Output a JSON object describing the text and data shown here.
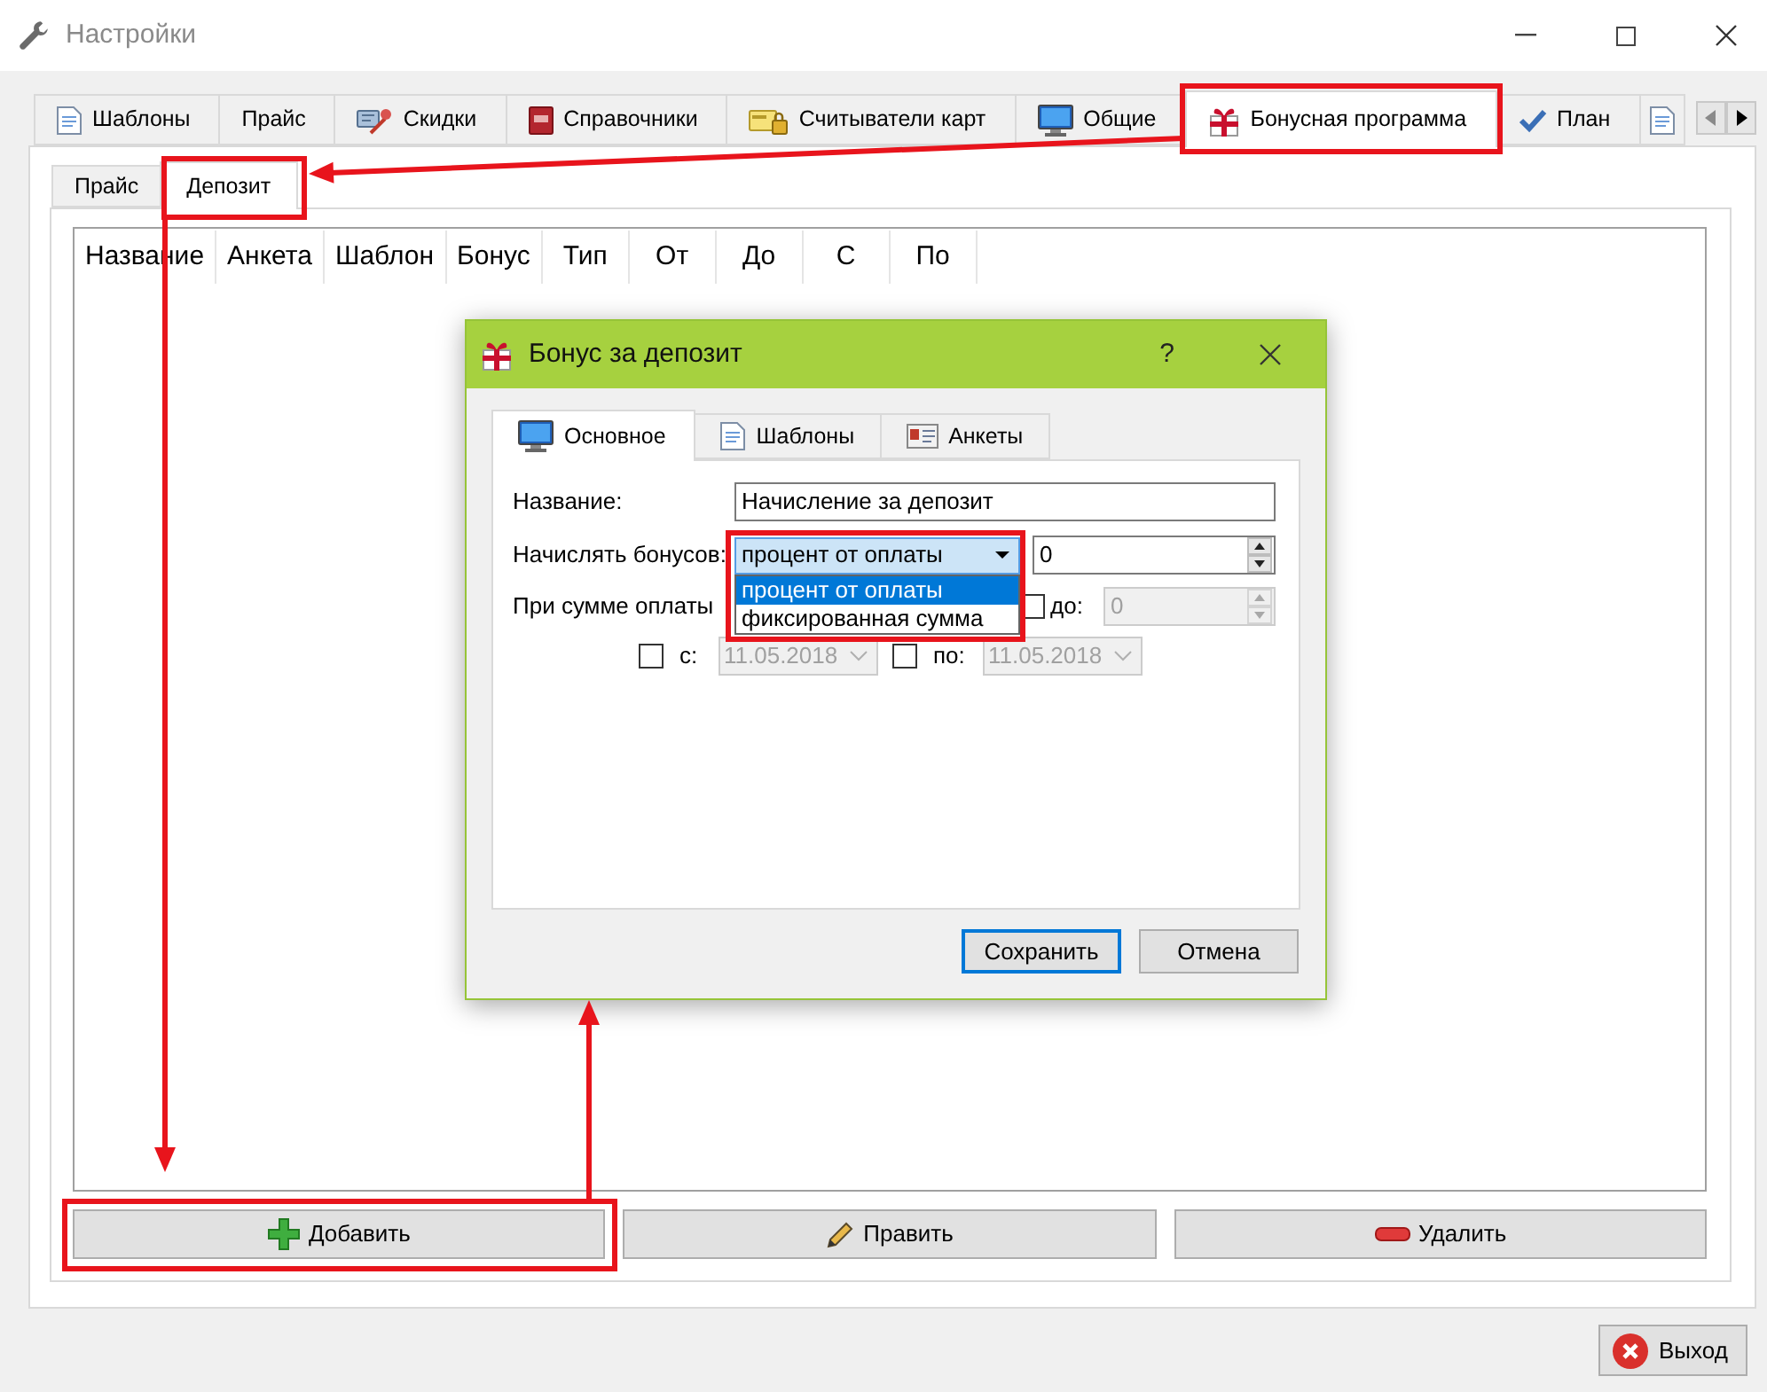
{
  "window": {
    "title": "Настройки"
  },
  "tabs": [
    {
      "label": "Шаблоны",
      "selected": false,
      "highlighted": false
    },
    {
      "label": "Прайс",
      "selected": false,
      "highlighted": false
    },
    {
      "label": "Скидки",
      "selected": false,
      "highlighted": false
    },
    {
      "label": "Справочники",
      "selected": false,
      "highlighted": false
    },
    {
      "label": "Считыватели карт",
      "selected": false,
      "highlighted": false
    },
    {
      "label": "Общие",
      "selected": false,
      "highlighted": false
    },
    {
      "label": "Бонусная программа",
      "selected": true,
      "highlighted": true
    },
    {
      "label": "План",
      "selected": false,
      "highlighted": false
    }
  ],
  "subtabs": [
    {
      "label": "Прайс",
      "selected": false,
      "highlighted": false
    },
    {
      "label": "Депозит",
      "selected": true,
      "highlighted": true
    }
  ],
  "table": {
    "columns": [
      "Название",
      "Анкета",
      "Шаблон",
      "Бонус",
      "Тип",
      "От",
      "До",
      "С",
      "По"
    ]
  },
  "actions": [
    {
      "label": "Добавить",
      "highlighted": true
    },
    {
      "label": "Править",
      "highlighted": false
    },
    {
      "label": "Удалить",
      "highlighted": false
    }
  ],
  "dialog": {
    "title": "Бонус за депозит",
    "help": "?",
    "tabs": [
      {
        "label": "Основное",
        "selected": true
      },
      {
        "label": "Шаблоны",
        "selected": false
      },
      {
        "label": "Анкеты",
        "selected": false
      }
    ],
    "name_field": {
      "label": "Название:",
      "value": "Начисление за депозит"
    },
    "accrual": {
      "label": "Начислять бонусов:",
      "value": "процент от оплаты",
      "expanded": true,
      "highlighted": true,
      "options": [
        {
          "label": "процент от оплаты",
          "selected": true
        },
        {
          "label": "фиксированная сумма",
          "selected": false
        }
      ],
      "amount": "0"
    },
    "payment_sum": {
      "label": "При сумме оплаты",
      "to": {
        "checked": false,
        "label": "до:",
        "value": "0",
        "disabled": true
      }
    },
    "period": [
      {
        "checked": false,
        "label": "с:",
        "value": "11.05.2018",
        "disabled": true
      },
      {
        "checked": false,
        "label": "по:",
        "value": "11.05.2018",
        "disabled": true
      }
    ],
    "buttons": [
      {
        "label": "Сохранить",
        "default": true
      },
      {
        "label": "Отмена",
        "default": false
      }
    ]
  },
  "exit_button": {
    "label": "Выход"
  }
}
